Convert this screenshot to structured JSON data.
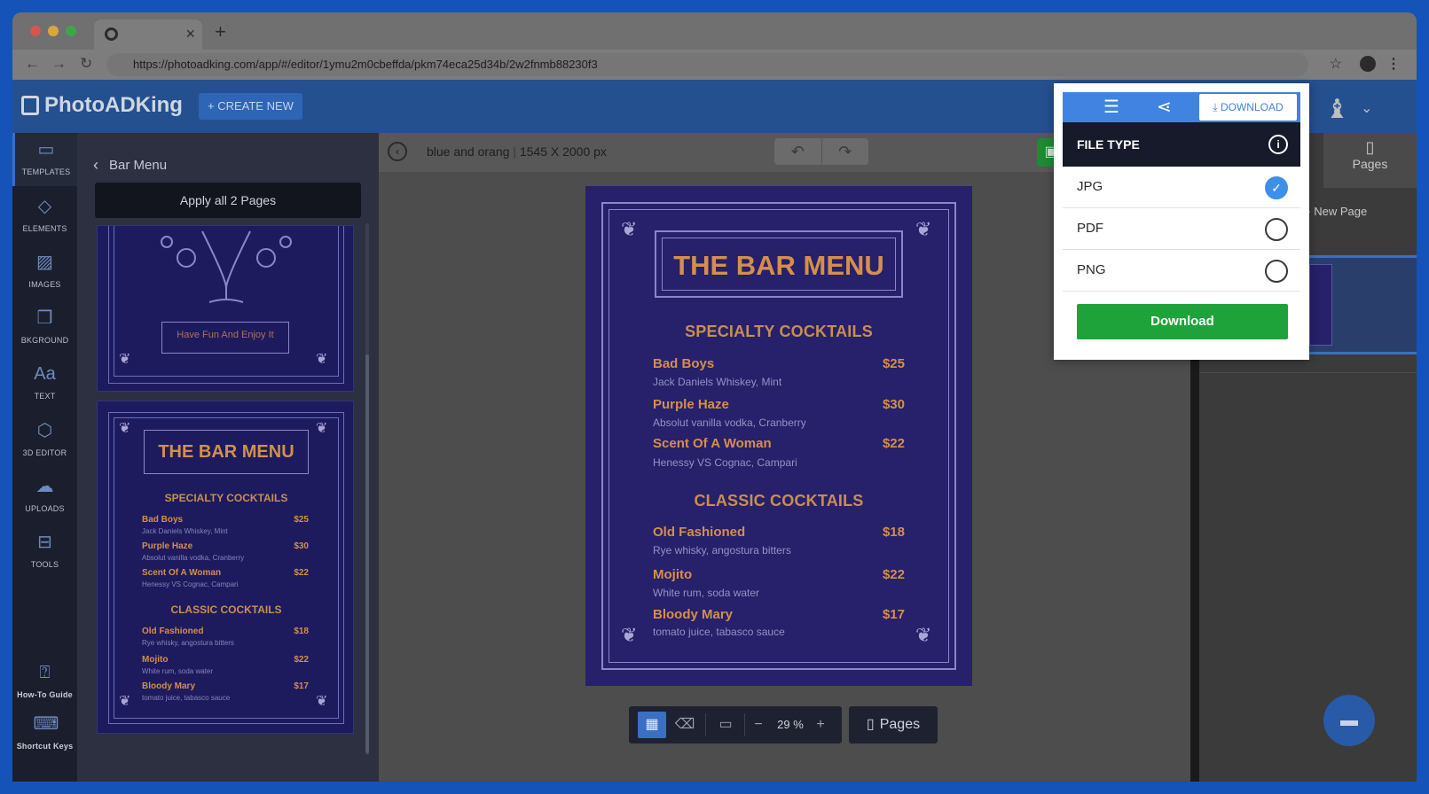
{
  "browser": {
    "tab_close": "×",
    "new_tab": "+",
    "url": "https://photoadking.com/app/#/editor/1ymu2m0cbeffda/pkm74eca25d34b/2w2fnmb88230f3"
  },
  "header": {
    "logo": "PhotoADKing",
    "create_new": "+ CREATE NEW"
  },
  "rail": {
    "items": [
      {
        "label": "TEMPLATES",
        "icon": "templates-icon"
      },
      {
        "label": "ELEMENTS",
        "icon": "elements-icon"
      },
      {
        "label": "IMAGES",
        "icon": "images-icon"
      },
      {
        "label": "BKGROUND",
        "icon": "background-icon"
      },
      {
        "label": "TEXT",
        "icon": "text-icon"
      },
      {
        "label": "3D EDITOR",
        "icon": "3d-editor-icon"
      },
      {
        "label": "UPLOADS",
        "icon": "upload-icon"
      },
      {
        "label": "TOOLS",
        "icon": "tools-icon"
      }
    ],
    "howto": "How-To Guide",
    "shortcuts": "Shortcut Keys"
  },
  "panel": {
    "title": "Bar Menu",
    "apply_all": "Apply all 2 Pages",
    "thumb1_tagline": "Have Fun And Enjoy It",
    "thumb2": {
      "title": "THE BAR MENU",
      "section1": "SPECIALTY COCKTAILS",
      "section2": "CLASSIC COCKTAILS"
    }
  },
  "editor": {
    "doc_name": "blue and orang",
    "doc_size": "1545 X 2000 px",
    "zoom": "29 %",
    "pages_button": "Pages"
  },
  "menu": {
    "title": "THE BAR MENU",
    "specialty_heading": "SPECIALTY COCKTAILS",
    "classic_heading": "CLASSIC COCKTAILS",
    "specialty": [
      {
        "name": "Bad Boys",
        "price": "$25",
        "desc": "Jack Daniels Whiskey, Mint"
      },
      {
        "name": "Purple Haze",
        "price": "$30",
        "desc": "Absolut vanilla vodka, Cranberry"
      },
      {
        "name": "Scent Of A Woman",
        "price": "$22",
        "desc": "Henessy VS Cognac, Campari"
      }
    ],
    "classic": [
      {
        "name": "Old Fashioned",
        "price": "$18",
        "desc": "Rye whisky, angostura bitters"
      },
      {
        "name": "Mojito",
        "price": "$22",
        "desc": "White rum, soda water"
      },
      {
        "name": "Bloody Mary",
        "price": "$17",
        "desc": "tomato juice, tabasco sauce"
      }
    ]
  },
  "pages_panel": {
    "tab": "Pages",
    "new_page": "+ New Page"
  },
  "download_popup": {
    "download_tab": "DOWNLOAD",
    "file_type_heading": "FILE TYPE",
    "options": [
      {
        "label": "JPG",
        "selected": true
      },
      {
        "label": "PDF",
        "selected": false
      },
      {
        "label": "PNG",
        "selected": false
      }
    ],
    "download_button": "Download"
  },
  "colors": {
    "accent_blue": "#4083e0",
    "download_green": "#1ea33a",
    "menu_bg": "#27206a",
    "menu_orange": "#d58f4a"
  }
}
